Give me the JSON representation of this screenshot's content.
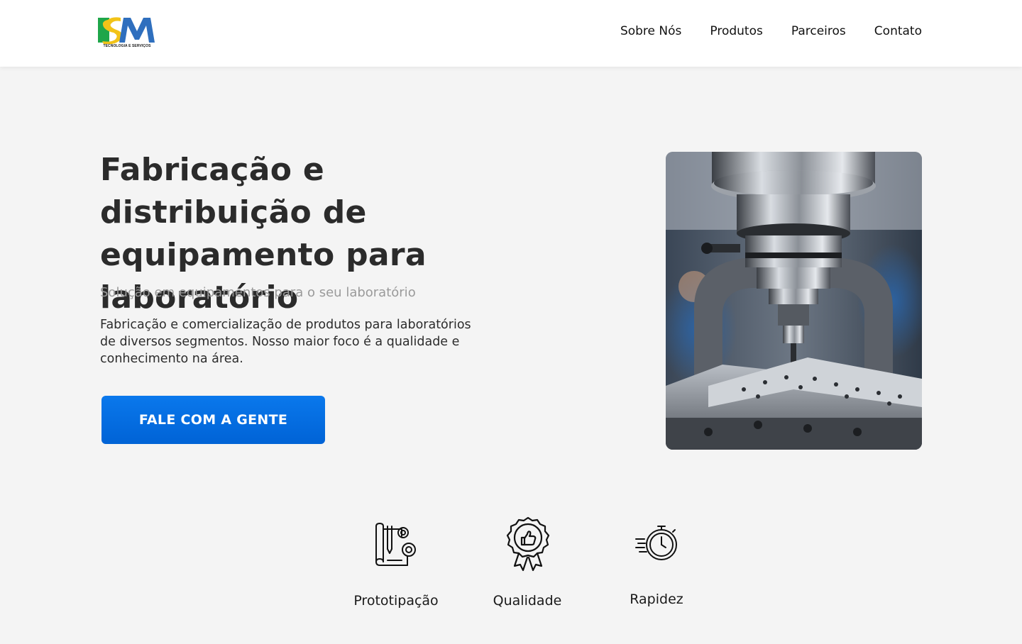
{
  "header": {
    "logo_text": "ISM",
    "logo_tagline": "TECNOLOGIA E SERVIÇOS",
    "nav": [
      {
        "label": "Sobre Nós"
      },
      {
        "label": "Produtos"
      },
      {
        "label": "Parceiros"
      },
      {
        "label": "Contato"
      }
    ]
  },
  "hero": {
    "title": "Fabricação e distribuição de equipamento para laboratório",
    "subtitle": "Solução em equipamentos para o seu laboratório",
    "description": "Fabricação e comercialização de produtos para laboratórios de diversos segmentos. Nosso maior foco é a qualidade e conhecimento na área.",
    "cta_label": "FALE COM A GENTE",
    "image": "cnc-milling-machine"
  },
  "features": [
    {
      "label": "Prototipação",
      "icon": "prototyping-icon"
    },
    {
      "label": "Qualidade",
      "icon": "quality-badge-icon"
    },
    {
      "label": "Rapidez",
      "icon": "stopwatch-icon"
    }
  ],
  "colors": {
    "background": "#f4f4f4",
    "header": "#ffffff",
    "cta": "#0a72e6",
    "title": "#2b2b2b",
    "subtitle": "#9a9a9a",
    "logo_green": "#1fa64a",
    "logo_yellow": "#f2c318",
    "logo_blue": "#2f6fbe"
  }
}
